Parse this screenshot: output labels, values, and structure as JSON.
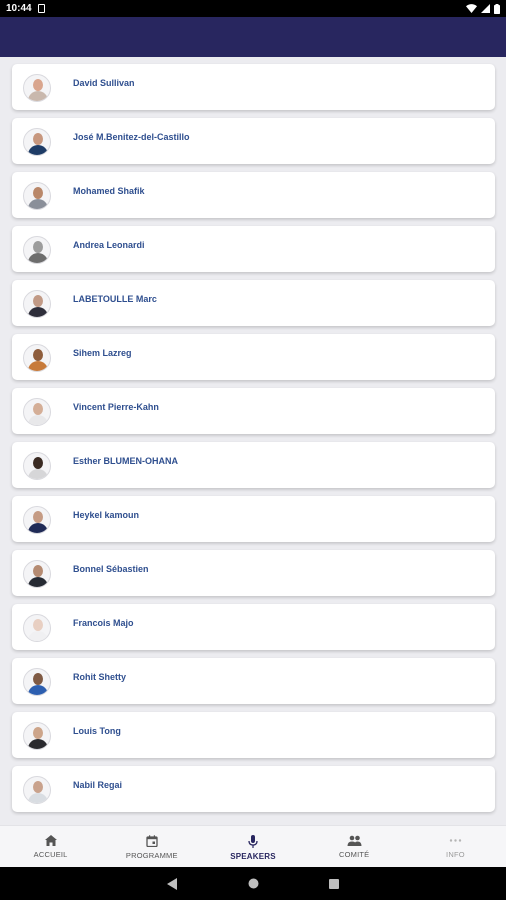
{
  "status_bar": {
    "time": "10:44"
  },
  "speakers": [
    {
      "name": "David Sullivan",
      "skin": "#d9a58d",
      "outfit": "#c9b8ad"
    },
    {
      "name": "José M.Benitez-del-Castillo",
      "skin": "#c7977e",
      "outfit": "#1e3c66"
    },
    {
      "name": "Mohamed Shafik",
      "skin": "#b98769",
      "outfit": "#8a8f99"
    },
    {
      "name": "Andrea Leonardi",
      "skin": "#9c9c9c",
      "outfit": "#6d6d6d"
    },
    {
      "name": "LABETOULLE Marc",
      "skin": "#c19a86",
      "outfit": "#2e2e3a"
    },
    {
      "name": "Sihem Lazreg",
      "skin": "#8e5d3c",
      "outfit": "#c77a3a"
    },
    {
      "name": "Vincent Pierre-Kahn",
      "skin": "#d4ae97",
      "outfit": "#e8e8ea"
    },
    {
      "name": "Esther BLUMEN-OHANA",
      "skin": "#3a2a22",
      "outfit": "#d6d6d8"
    },
    {
      "name": "Heykel kamoun",
      "skin": "#c59b84",
      "outfit": "#1f2a56"
    },
    {
      "name": "Bonnel Sébastien",
      "skin": "#b58b72",
      "outfit": "#262a33"
    },
    {
      "name": "Francois Majo",
      "skin": "#e8cfc2",
      "outfit": "#f0f0f2"
    },
    {
      "name": "Rohit Shetty",
      "skin": "#7f5a44",
      "outfit": "#2d5fb0"
    },
    {
      "name": "Louis Tong",
      "skin": "#cda58a",
      "outfit": "#2a2a2e"
    },
    {
      "name": "Nabil Regai",
      "skin": "#c9a28c",
      "outfit": "#d9dde2"
    }
  ],
  "bottom_nav": [
    {
      "label": "ACCUEIL",
      "icon": "home-icon"
    },
    {
      "label": "PROGRAMME",
      "icon": "calendar-icon"
    },
    {
      "label": "SPEAKERS",
      "icon": "microphone-icon",
      "active": true
    },
    {
      "label": "COMITÉ",
      "icon": "people-icon"
    },
    {
      "label": "INFO",
      "icon": "more-icon"
    }
  ],
  "colors": {
    "app_bar": "#28265f",
    "name_text": "#2f4f8f",
    "active_nav": "#28265f"
  }
}
